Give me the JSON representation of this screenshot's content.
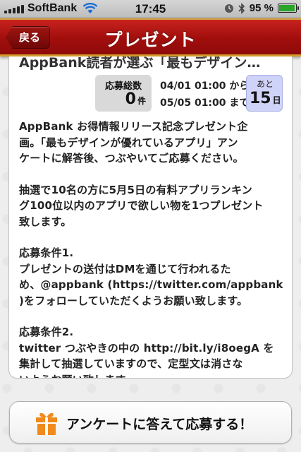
{
  "status_bar": {
    "carrier": "SoftBank",
    "time": "17:45",
    "battery": "95 %",
    "battery_level": 0.95,
    "icons": [
      "signal-icon",
      "wifi-icon",
      "clock-icon",
      "bluetooth-icon",
      "battery-icon"
    ]
  },
  "nav": {
    "back_label": "戻る",
    "title": "プレゼント"
  },
  "card": {
    "title": "AppBank読者が選ぶ「最もデザイン…",
    "count_label": "応募総数",
    "count_value": "0",
    "count_unit": "件",
    "date_start": "04/01 01:00 から",
    "date_end": "05/05 01:00 まで",
    "days_label": "あと",
    "days_value": "15",
    "days_unit": "日",
    "paragraphs": [
      {
        "lines": [
          "AppBank お得情報リリース記念プレゼント企",
          "画。「最もデザインが優れているアプリ」アン",
          "ケートに解答後、つぶやいてご応募ください。"
        ]
      },
      {
        "lines": [
          "抽選で10名の方に5月5日の有料アプリランキン",
          "グ100位以内のアプリで欲しい物を1つプレゼント",
          "致します。"
        ]
      },
      {
        "lines": [
          "応募条件1.",
          "プレゼントの送付はDMを通じて行われるた",
          "め、@appbank (https://twitter.com/appbank",
          ")をフォローしていただくようお願い致します。"
        ]
      },
      {
        "lines": [
          "応募条件2.",
          "twitter つぶやきの中の http://bit.ly/i8oegA を",
          "集計して抽選していますので、定型文は消さな",
          "いようお願い致します。"
        ]
      }
    ]
  },
  "apply_button": {
    "label": "アンケートに答えて応募する！"
  },
  "colors": {
    "nav_red": "#a30f0d",
    "nav_gold": "#d49a2a",
    "days_box": "#cfd3f7",
    "gift_orange": "#f08a1c"
  }
}
